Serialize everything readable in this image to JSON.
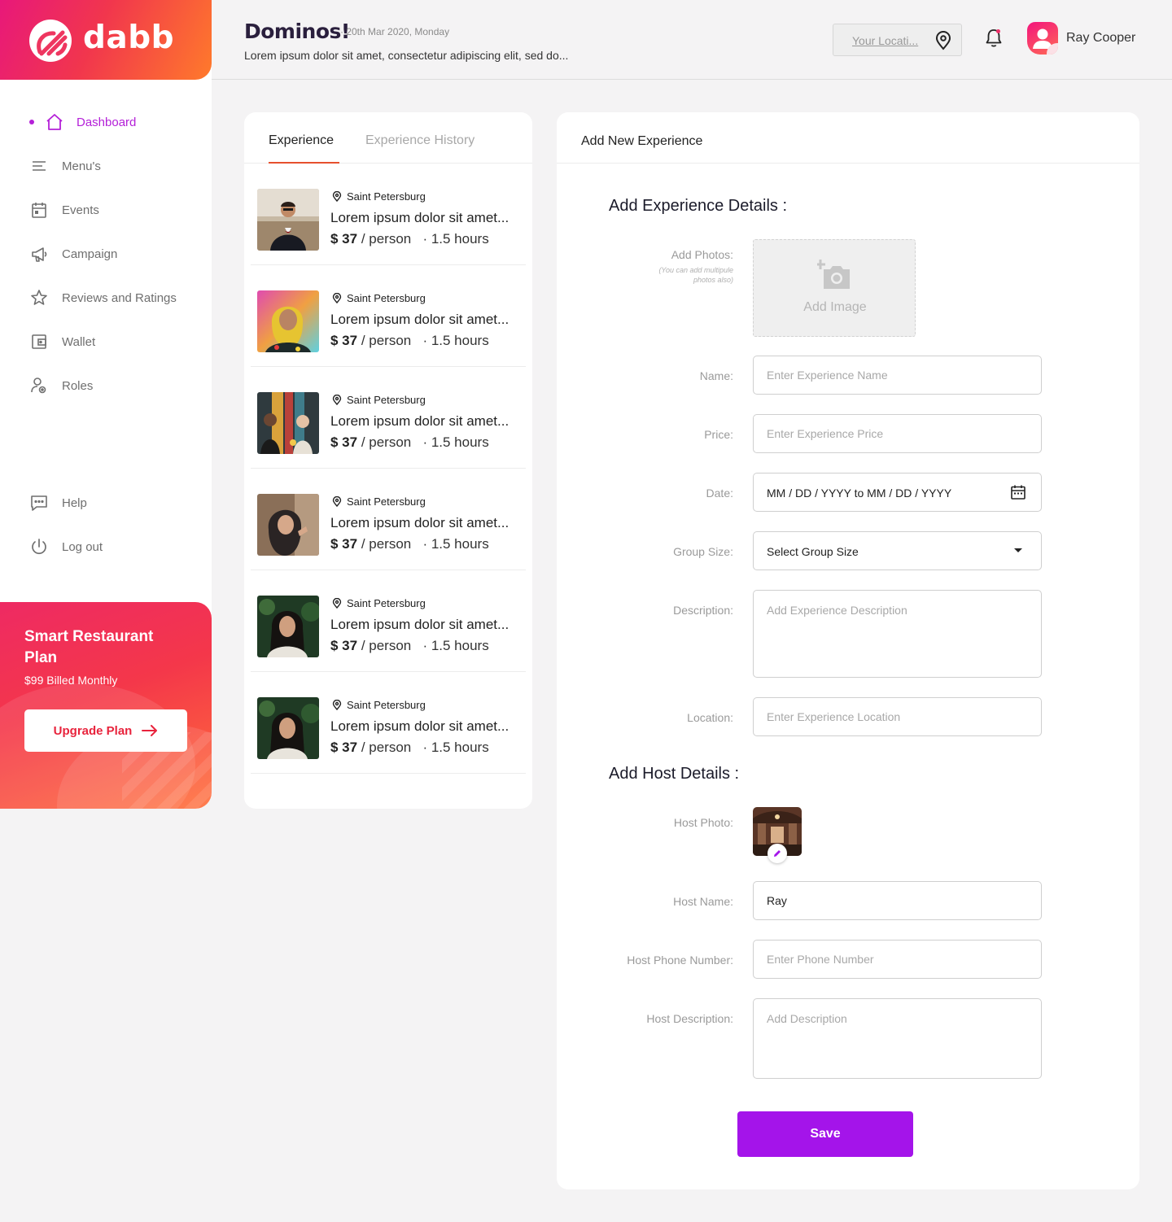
{
  "brand": {
    "name": "dabb"
  },
  "sidebar": {
    "items": [
      {
        "label": "Dashboard",
        "icon": "home-icon",
        "active": true
      },
      {
        "label": "Menu's",
        "icon": "menu-lines-icon"
      },
      {
        "label": "Events",
        "icon": "calendar-icon"
      },
      {
        "label": "Campaign",
        "icon": "megaphone-icon"
      },
      {
        "label": "Reviews and Ratings",
        "icon": "star-icon"
      },
      {
        "label": "Wallet",
        "icon": "wallet-icon"
      },
      {
        "label": "Roles",
        "icon": "roles-icon"
      }
    ],
    "bottom_items": [
      {
        "label": "Help",
        "icon": "chat-icon"
      },
      {
        "label": "Log out",
        "icon": "power-icon"
      }
    ],
    "promo": {
      "title": "Smart Restaurant Plan",
      "subtitle": "$99 Billed Monthly",
      "button_label": "Upgrade Plan"
    }
  },
  "header": {
    "title": "Dominos!",
    "date": "· 20th Mar 2020, Monday",
    "subtitle": "Lorem ipsum dolor sit amet, consectetur adipiscing elit, sed do...",
    "location_placeholder": "Your Locati...",
    "user_name": "Ray Cooper"
  },
  "experience_list": {
    "tabs": [
      {
        "label": "Experience",
        "active": true
      },
      {
        "label": "Experience History",
        "active": false
      }
    ],
    "items": [
      {
        "location": "Saint Petersburg",
        "title": "Lorem ipsum dolor sit amet...",
        "price": "$ 37",
        "unit": "/ person",
        "duration": "· 1.5 hours"
      },
      {
        "location": "Saint Petersburg",
        "title": "Lorem ipsum dolor sit amet...",
        "price": "$ 37",
        "unit": "/ person",
        "duration": "· 1.5 hours"
      },
      {
        "location": "Saint Petersburg",
        "title": "Lorem ipsum dolor sit amet...",
        "price": "$ 37",
        "unit": "/ person",
        "duration": "· 1.5 hours"
      },
      {
        "location": "Saint Petersburg",
        "title": "Lorem ipsum dolor sit amet...",
        "price": "$ 37",
        "unit": "/ person",
        "duration": "· 1.5 hours"
      },
      {
        "location": "Saint Petersburg",
        "title": "Lorem ipsum dolor sit amet...",
        "price": "$ 37",
        "unit": "/ person",
        "duration": "· 1.5 hours"
      },
      {
        "location": "Saint Petersburg",
        "title": "Lorem ipsum dolor sit amet...",
        "price": "$ 37",
        "unit": "/ person",
        "duration": "· 1.5 hours"
      }
    ]
  },
  "form": {
    "header": "Add New Experience",
    "experience_section": "Add Experience Details :",
    "photos": {
      "label": "Add Photos:",
      "note": "(You can add multipule photos also)",
      "button": "Add Image"
    },
    "name": {
      "label": "Name:",
      "placeholder": "Enter Experience Name"
    },
    "price": {
      "label": "Price:",
      "placeholder": "Enter Experience Price"
    },
    "date": {
      "label": "Date:",
      "value": "MM / DD / YYYY to MM / DD / YYYY"
    },
    "group_size": {
      "label": "Group Size:",
      "value": "Select Group Size"
    },
    "description": {
      "label": "Description:",
      "placeholder": "Add Experience Description"
    },
    "location": {
      "label": "Location:",
      "placeholder": "Enter Experience Location"
    },
    "host_section": "Add Host Details :",
    "host_photo": {
      "label": "Host Photo:"
    },
    "host_name": {
      "label": "Host Name:",
      "value": "Ray"
    },
    "host_phone": {
      "label": "Host Phone Number:",
      "placeholder": "Enter Phone Number"
    },
    "host_description": {
      "label": "Host Description:",
      "placeholder": "Add Description"
    },
    "save_label": "Save"
  },
  "colors": {
    "accent": "#a414ea",
    "active_nav": "#b420d8",
    "brand_start": "#e8187a",
    "brand_end": "#ff7a2b",
    "tab_underline": "#e6502e"
  }
}
